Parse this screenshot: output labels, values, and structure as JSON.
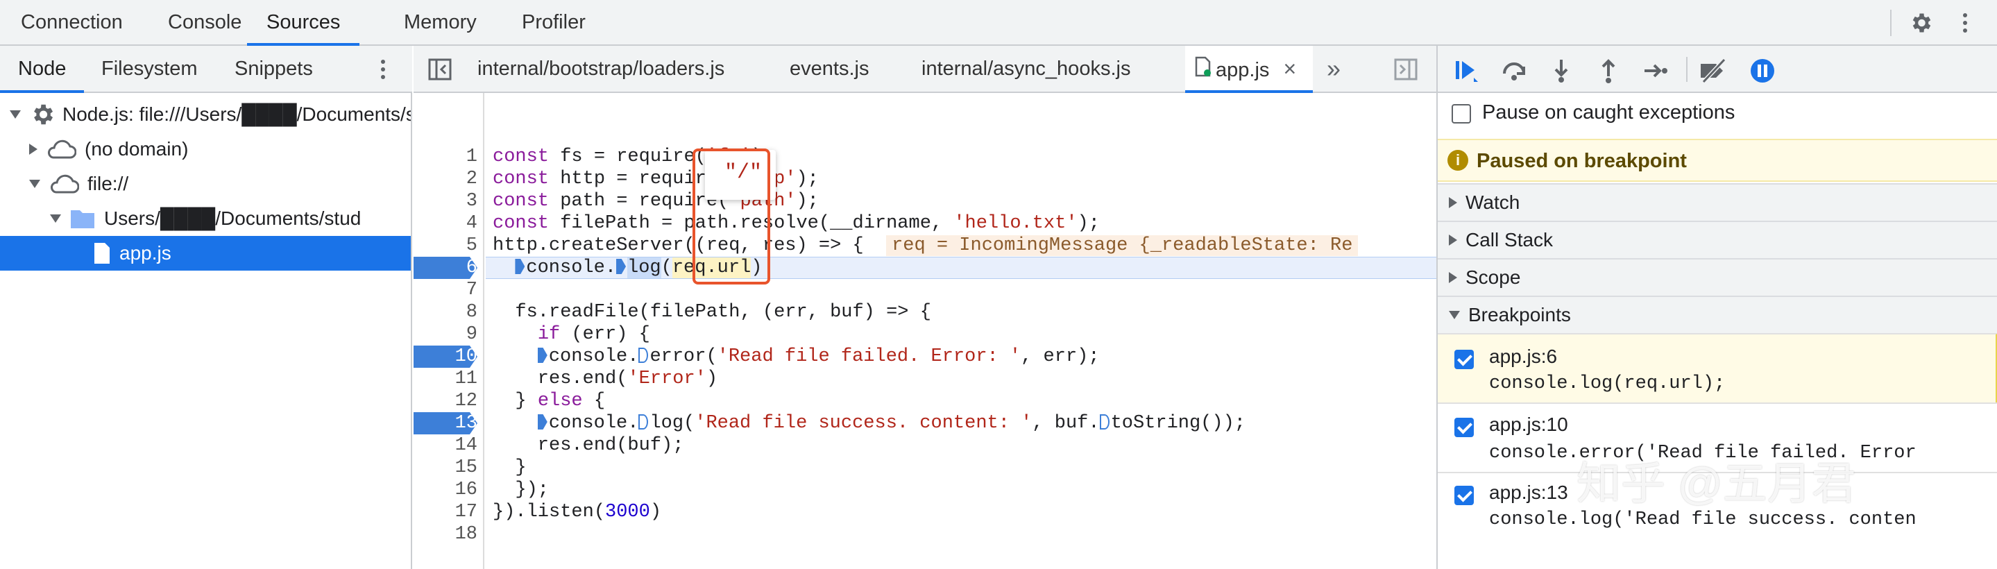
{
  "panel_tabs": [
    "Connection",
    "Console",
    "Sources",
    "Memory",
    "Profiler"
  ],
  "navigator": {
    "tabs": [
      "Node",
      "Filesystem",
      "Snippets"
    ],
    "tree": [
      {
        "label": "Node.js: file:///Users/████/Documents/stud"
      },
      {
        "label": "(no domain)"
      },
      {
        "label": "file://"
      },
      {
        "label": "Users/████/Documents/stud"
      },
      {
        "label": "app.js"
      }
    ]
  },
  "editor": {
    "tabs": [
      "internal/bootstrap/loaders.js",
      "events.js",
      "internal/async_hooks.js",
      "app.js"
    ],
    "close_glyph": "×",
    "more_glyph": "»",
    "line_numbers": [
      "1",
      "2",
      "3",
      "4",
      "5",
      "6",
      "7",
      "8",
      "9",
      "10",
      "11",
      "12",
      "13",
      "14",
      "15",
      "16",
      "17",
      "18"
    ],
    "hover_value": "\"/\"",
    "inline_value": "req = IncomingMessage {_readableState: Re"
  },
  "debugger": {
    "pause_caught": "Pause on caught exceptions",
    "status": "Paused on breakpoint",
    "sections": [
      "Watch",
      "Call Stack",
      "Scope",
      "Breakpoints"
    ],
    "breakpoints": [
      {
        "location": "app.js:6",
        "code": "console.log(req.url);"
      },
      {
        "location": "app.js:10",
        "code": "console.error('Read file failed. Error"
      },
      {
        "location": "app.js:13",
        "code": "console.log('Read file success. conten"
      }
    ]
  },
  "watermark": "知乎 @五月君",
  "colors": {
    "accent": "#1a73e8",
    "breakpoint": "#3d7fd8",
    "paused_banner": "#fffbe6",
    "highlight_box": "#e8542c"
  }
}
